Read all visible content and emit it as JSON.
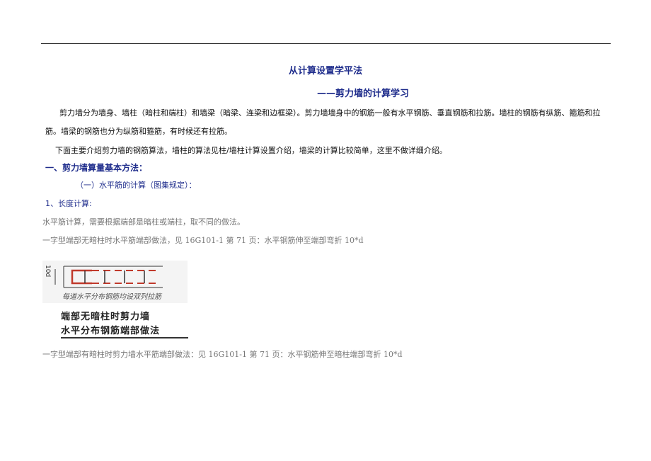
{
  "title": "从计算设置学平法",
  "subtitle": "——剪力墙的计算学习",
  "intro": "剪力墙分为墙身、墙柱（暗柱和端柱）和墙梁（暗梁、连梁和边框梁）。剪力墙墙身中的钢筋一般有水平钢筋、垂直钢筋和拉筋。墙柱的钢筋有纵筋、箍筋和拉筋。墙梁的钢筋也分为纵筋和箍筋，有时候还有拉筋。",
  "intro2": "下面主要介绍剪力墙的钢筋算法，墙柱的算法见柱/墙柱计算设置介绍，墙梁的计算比较简单，这里不做详细介绍。",
  "section1": "一、剪力墙算量基本方法：",
  "section1_1": "（一）水平筋的计算（图集规定）：",
  "section1_1_1": "1、长度计算:",
  "line1": "水平筋计算，需要根据端部是暗柱或端柱，取不同的做法。",
  "line2": "一字型端部无暗柱时水平筋端部做法，见 16G101-1 第 71 页：水平钢筋伸至端部弯折 10*d",
  "figure": {
    "dim_label": "10d",
    "note": "每道水平分布钢筋均设双列拉筋",
    "caption_line1": "端部无暗柱时剪力墙",
    "caption_line2": "水平分布钢筋端部做法"
  },
  "line3": "一字型端部有暗柱时剪力墙水平筋端部做法：见 16G101-1 第 71 页：水平钢筋伸至暗柱端部弯折 10*d",
  "colors": {
    "heading": "#1f2d8c",
    "rebar": "#c0392b"
  }
}
